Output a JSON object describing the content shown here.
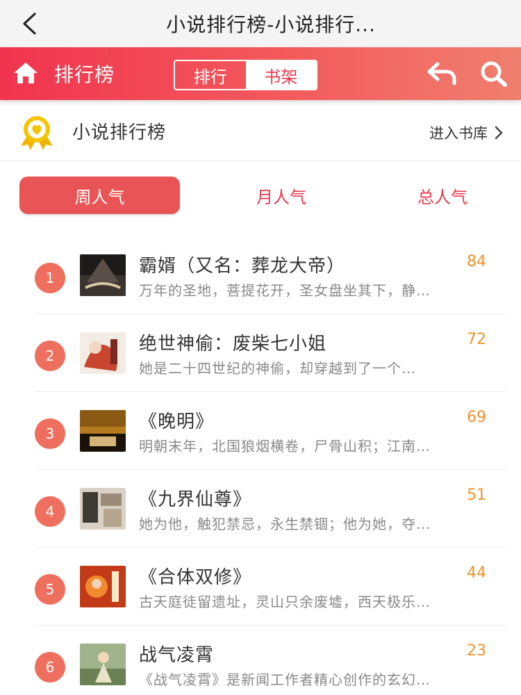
{
  "topbar": {
    "title": "小说排行榜-小说排行..."
  },
  "header": {
    "title": "排行榜",
    "segments": [
      {
        "label": "排行",
        "active": true
      },
      {
        "label": "书架",
        "active": false
      }
    ]
  },
  "ranking": {
    "title": "小说排行榜",
    "library_link": "进入书库"
  },
  "period_tabs": [
    {
      "label": "周人气",
      "active": true
    },
    {
      "label": "月人气",
      "active": false
    },
    {
      "label": "总人气",
      "active": false
    }
  ],
  "books": [
    {
      "rank": "1",
      "title": "霸婿（又名：葬龙大帝）",
      "score": "84",
      "desc": "万年的圣地，菩提花开，圣女盘坐其下，静…"
    },
    {
      "rank": "2",
      "title": "绝世神偷：废柴七小姐",
      "score": "72",
      "desc": "她是二十四世纪的神偷，却穿越到了一个…"
    },
    {
      "rank": "3",
      "title": "《晚明》",
      "score": "69",
      "desc": "明朝末年，北国狼烟横卷，尸骨山积；江南…"
    },
    {
      "rank": "4",
      "title": "《九界仙尊》",
      "score": "51",
      "desc": "她为他，触犯禁忌，永生禁锢；他为她，夺…"
    },
    {
      "rank": "5",
      "title": "《合体双修》",
      "score": "44",
      "desc": "古天庭徒留遗址，灵山只余废墟，西天极乐…"
    },
    {
      "rank": "6",
      "title": "战气凌霄",
      "score": "23",
      "desc": "《战气凌霄》是新闻工作者精心创作的玄幻…"
    }
  ],
  "colors": {
    "accent": "#e8394e",
    "score": "#f0922b",
    "badge": "#ee6f5d"
  },
  "icons": [
    "back-icon",
    "home-icon",
    "return-icon",
    "search-icon",
    "medal-icon",
    "chevron-right-icon"
  ]
}
